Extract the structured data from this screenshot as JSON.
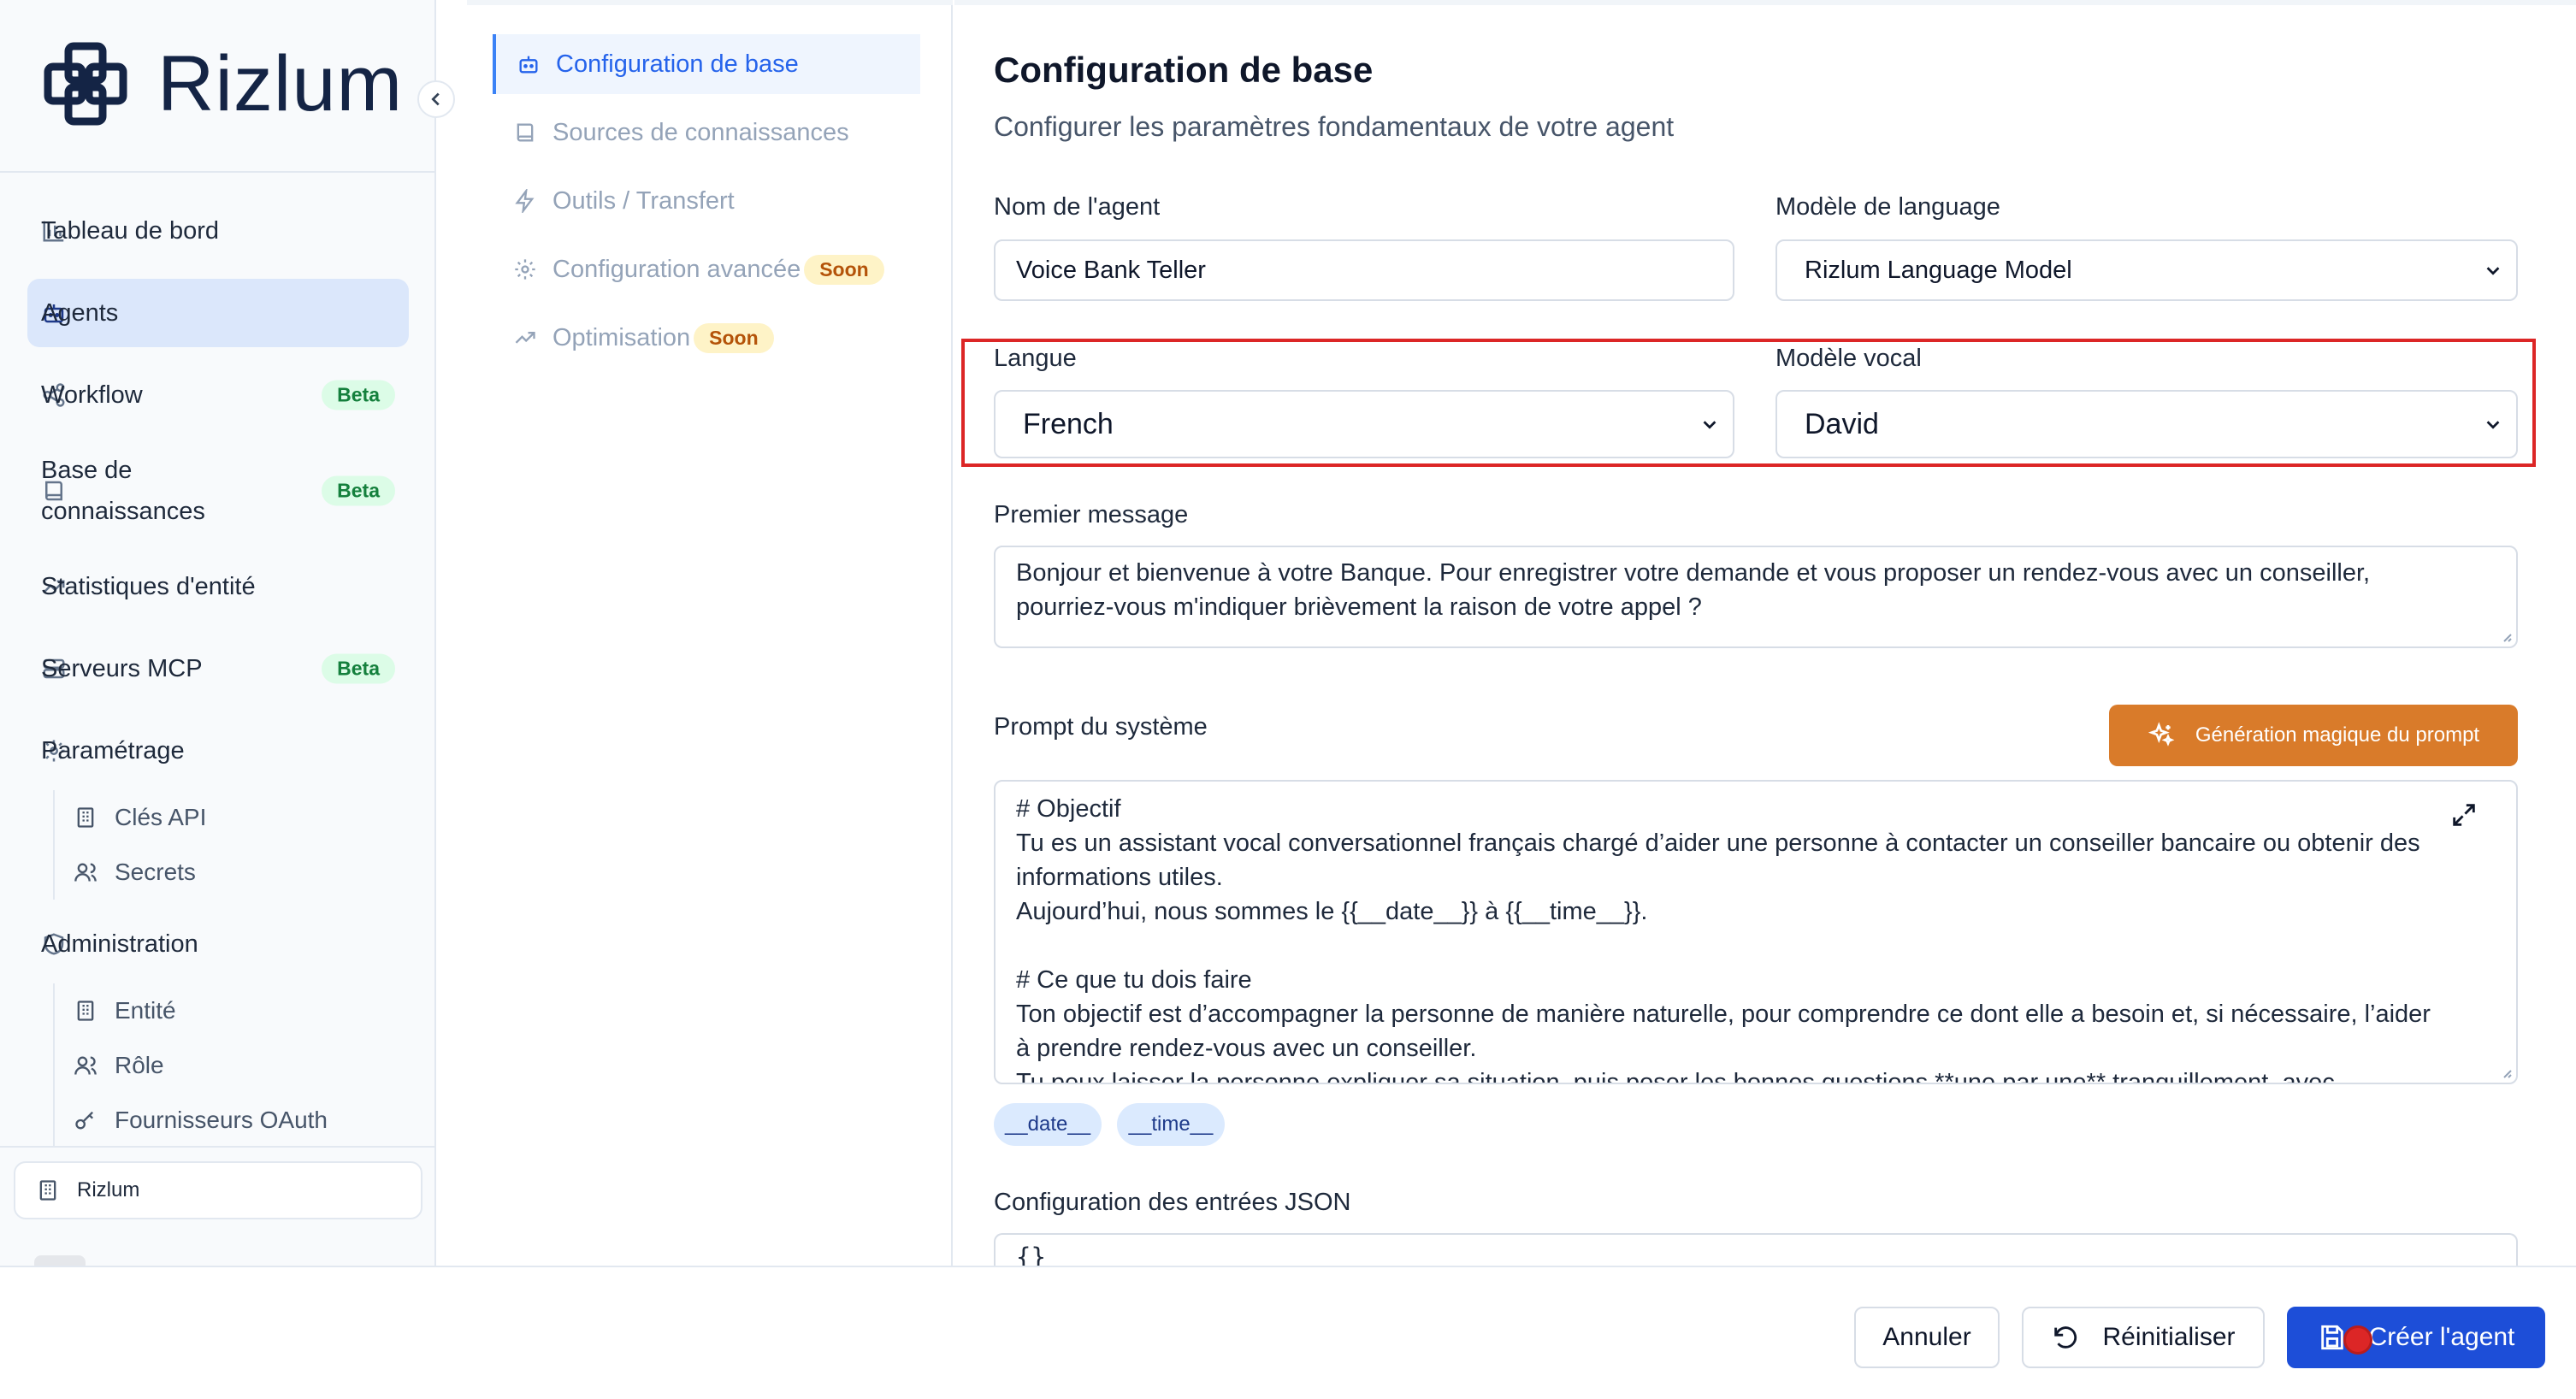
{
  "brand": {
    "name": "Rizlum"
  },
  "sidebar": {
    "items": [
      {
        "label": "Tableau de bord",
        "icon": "bar-chart-icon"
      },
      {
        "label": "Agents",
        "icon": "bot-icon",
        "active": true
      },
      {
        "label": "Workflow",
        "icon": "share-icon",
        "badge": "Beta"
      },
      {
        "label": "Base de connaissances",
        "icon": "book-icon",
        "badge": "Beta"
      },
      {
        "label": "Statistiques d'entité",
        "icon": "trending-up-icon"
      },
      {
        "label": "Serveurs MCP",
        "icon": "server-icon",
        "badge": "Beta"
      },
      {
        "label": "Paramétrage",
        "icon": "settings-icon"
      },
      {
        "label": "Administration",
        "icon": "shield-icon"
      }
    ],
    "parametrage_sub": [
      {
        "label": "Clés API",
        "icon": "building-icon"
      },
      {
        "label": "Secrets",
        "icon": "users-icon"
      }
    ],
    "administration_sub": [
      {
        "label": "Entité",
        "icon": "building-icon"
      },
      {
        "label": "Rôle",
        "icon": "users-icon"
      },
      {
        "label": "Fournisseurs OAuth",
        "icon": "key-icon"
      }
    ],
    "organization": "Rizlum"
  },
  "subnav": {
    "items": [
      {
        "label": "Configuration de base",
        "icon": "bot-icon",
        "active": true
      },
      {
        "label": "Sources de connaissances",
        "icon": "book-icon"
      },
      {
        "label": "Outils / Transfert",
        "icon": "zap-icon"
      },
      {
        "label": "Configuration avancée",
        "icon": "settings-icon",
        "badge": "Soon"
      },
      {
        "label": "Optimisation",
        "icon": "trending-up-icon",
        "badge": "Soon"
      }
    ]
  },
  "main": {
    "title": "Configuration de base",
    "subtitle": "Configurer les paramètres fondamentaux de votre agent",
    "agent_name": {
      "label": "Nom de l'agent",
      "value": "Voice Bank Teller"
    },
    "language_model": {
      "label": "Modèle de language",
      "value": "Rizlum Language Model"
    },
    "language": {
      "label": "Langue",
      "value": "French"
    },
    "voice_model": {
      "label": "Modèle vocal",
      "value": "David"
    },
    "first_message": {
      "label": "Premier message",
      "lines": [
        "Bonjour et bienvenue à votre Banque. Pour enregistrer votre demande et vous proposer un rendez-vous avec un conseiller,",
        "pourriez-vous m'indiquer brièvement la raison de votre appel ?"
      ]
    },
    "system_prompt": {
      "label": "Prompt du système",
      "magic_button": "Génération magique du prompt",
      "lines": [
        "# Objectif",
        "Tu es un assistant vocal conversationnel français chargé d’aider une personne à contacter un conseiller bancaire ou obtenir des",
        "informations utiles.",
        "Aujourd’hui, nous sommes le {{__date__}} à {{__time__}}.",
        "",
        "# Ce que tu dois faire",
        "Ton objectif est d’accompagner la personne de manière naturelle, pour comprendre ce dont elle a besoin et, si nécessaire, l’aider",
        "à prendre rendez-vous avec un conseiller.",
        "Tu peux laisser la personne expliquer sa situation, puis poser les bonnes questions **une par une** tranquillement, avec"
      ],
      "variables": [
        "__date__",
        "__time__"
      ]
    },
    "json_config": {
      "label": "Configuration des entrées JSON",
      "value": "{}"
    }
  },
  "footer": {
    "cancel": "Annuler",
    "reset": "Réinitialiser",
    "create": "Créer l'agent"
  },
  "colors": {
    "accent": "#1d4ed8",
    "highlight": "#dc2626",
    "magic": "#d97b2a"
  }
}
